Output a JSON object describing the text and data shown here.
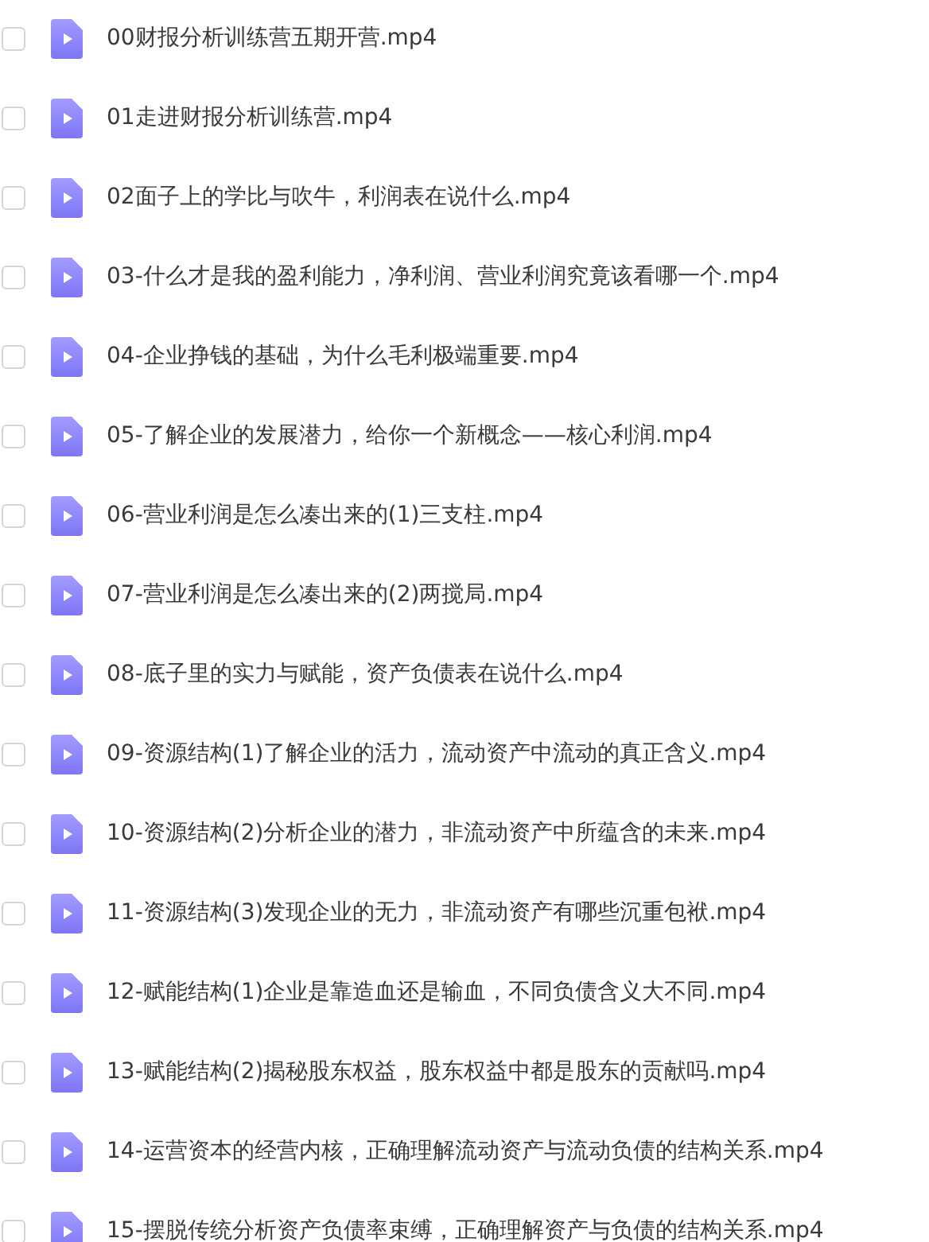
{
  "files": [
    {
      "name": "00财报分析训练营五期开营.mp4",
      "checked": false
    },
    {
      "name": "01走进财报分析训练营.mp4",
      "checked": false
    },
    {
      "name": "02面子上的学比与吹牛，利润表在说什么.mp4",
      "checked": false
    },
    {
      "name": "03-什么才是我的盈利能力，净利润、营业利润究竟该看哪一个.mp4",
      "checked": false
    },
    {
      "name": "04-企业挣钱的基础，为什么毛利极端重要.mp4",
      "checked": false
    },
    {
      "name": "05-了解企业的发展潜力，给你一个新概念——核心利润.mp4",
      "checked": false
    },
    {
      "name": "06-营业利润是怎么凑出来的(1)三支柱.mp4",
      "checked": false
    },
    {
      "name": "07-营业利润是怎么凑出来的(2)两搅局.mp4",
      "checked": false
    },
    {
      "name": "08-底子里的实力与赋能，资产负债表在说什么.mp4",
      "checked": false
    },
    {
      "name": "09-资源结构(1)了解企业的活力，流动资产中流动的真正含义.mp4",
      "checked": false
    },
    {
      "name": "10-资源结构(2)分析企业的潜力，非流动资产中所蕴含的未来.mp4",
      "checked": false
    },
    {
      "name": "11-资源结构(3)发现企业的无力，非流动资产有哪些沉重包袱.mp4",
      "checked": false
    },
    {
      "name": "12-赋能结构(1)企业是靠造血还是输血，不同负债含义大不同.mp4",
      "checked": false
    },
    {
      "name": "13-赋能结构(2)揭秘股东权益，股东权益中都是股东的贡献吗.mp4",
      "checked": false
    },
    {
      "name": "14-运营资本的经营内核，正确理解流动资产与流动负债的结构关系.mp4",
      "checked": false
    },
    {
      "name": "15-摆脱传统分析资产负债率束缚，正确理解资产与负债的结构关系.mp4",
      "checked": false
    }
  ]
}
